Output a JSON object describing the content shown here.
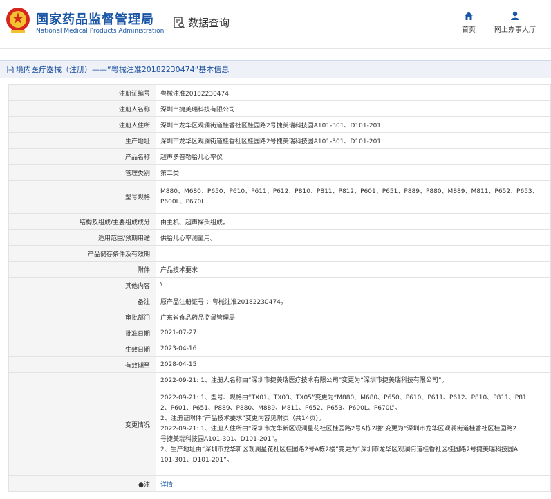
{
  "header": {
    "org_name_cn": "国家药品监督管理局",
    "org_name_en": "National Medical Products Administration",
    "query_label": "数据查询",
    "nav": [
      {
        "label": "首页",
        "icon": "home-icon"
      },
      {
        "label": "网上办事大厅",
        "icon": "user-icon"
      }
    ],
    "brand_color": "#1a56a6"
  },
  "title_bar": {
    "text": "境内医疗器械（注册）——“粤械注准20182230474”基本信息"
  },
  "fields": {
    "reg_no": {
      "label": "注册证编号",
      "value": "粤械注准20182230474"
    },
    "registrant": {
      "label": "注册人名称",
      "value": "深圳市捷美瑞科技有限公司"
    },
    "registrant_addr": {
      "label": "注册人住所",
      "value": "深圳市龙华区观澜街道桂香社区桂园路2号捷美瑞科技园A101-301、D101-201"
    },
    "production_addr": {
      "label": "生产地址",
      "value": "深圳市龙华区观澜街道桂香社区桂园路2号捷美瑞科技园A101-301、D101-201"
    },
    "product_name": {
      "label": "产品名称",
      "value": "超声多普勒胎儿心率仪"
    },
    "category": {
      "label": "管理类别",
      "value": "第二类"
    },
    "models": {
      "label": "型号规格",
      "line1": "M880、M680、P650、P610、P611、P612、P810、P811、P812、P601、P651、P889、P880、M889、M811、P652、P653、",
      "line2": "P600L、P670L"
    },
    "structure": {
      "label": "结构及组成/主要组成成分",
      "value": "由主机、超声探头组成。"
    },
    "intended_use": {
      "label": "适用范围/预期用途",
      "value": "供胎儿心率测量用。"
    },
    "storage": {
      "label": "产品储存条件及有效期",
      "value": ""
    },
    "attachment": {
      "label": "附件",
      "value": "产品技术要求"
    },
    "other": {
      "label": "其他内容",
      "value": "\\"
    },
    "remarks": {
      "label": "备注",
      "value": "原产品注册证号 ：粤械注准20182230474。"
    },
    "approval_dept": {
      "label": "审批部门",
      "value": "广东省食品药品监督管理局"
    },
    "approval_date": {
      "label": "批准日期",
      "value": "2021-07-27"
    },
    "effective_date": {
      "label": "生效日期",
      "value": "2023-04-16"
    },
    "expiry_date": {
      "label": "有效期至",
      "value": "2028-04-15"
    },
    "changes": {
      "label": "变更情况",
      "p1": "2022-09-21: 1、注册人名称由“深圳市捷美瑞医疗技术有限公司”变更为“深圳市捷美瑞科技有限公司”。",
      "p2a": "2022-09-21: 1、型号、规格由“TX01、TX03、TX05”变更为“M880、M680、P650、P610、P611、P612、P810、P811、P81",
      "p2b": "2、P601、P651、P889、P880、M889、M811、P652、P653、P600L、P670L”。",
      "p2c": "2、注册证附件“产品技术要求”变更内容见附页（共14页）。",
      "p3a": "2022-09-21: 1、注册人住所由“深圳市龙华新区观澜星花社区桂园路2号A栋2楼”变更为“深圳市龙华区观澜街道桂香社区桂园路2",
      "p3b": "号捷美瑞科技园A101-301、D101-201”。",
      "p3c": "2、生产地址由“深圳市龙华新区观澜星花社区桂园路2号A栋2楼”变更为“深圳市龙华区观澜街道桂香社区桂园路2号捷美瑞科技园A",
      "p3d": "101-301、D101-201”。"
    },
    "note": {
      "label": "●注",
      "value": "详情"
    }
  }
}
